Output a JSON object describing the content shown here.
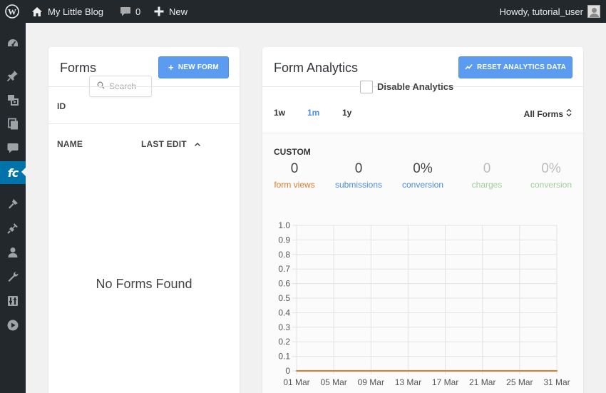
{
  "adminbar": {
    "site_name": "My Little Blog",
    "comment_count": "0",
    "new_label": "New",
    "howdy": "Howdy, tutorial_user"
  },
  "sidebar": {
    "items": [
      {
        "name": "dashboard-icon"
      },
      {
        "name": "posts-pin-icon"
      },
      {
        "name": "media-icon"
      },
      {
        "name": "pages-icon"
      },
      {
        "name": "comments-icon"
      },
      {
        "name": "formcraft-icon",
        "label": "fc",
        "active": true
      },
      {
        "name": "appearance-icon"
      },
      {
        "name": "plugins-icon"
      },
      {
        "name": "users-icon"
      },
      {
        "name": "tools-icon"
      },
      {
        "name": "settings-icon"
      },
      {
        "name": "media-player-icon"
      }
    ]
  },
  "forms": {
    "title": "Forms",
    "new_button": "NEW FORM",
    "search_placeholder": "Search",
    "col_id": "ID",
    "col_name": "NAME",
    "col_last_edit": "LAST EDIT",
    "empty": "No Forms Found"
  },
  "analytics": {
    "title": "Form Analytics",
    "reset_button": "RESET ANALYTICS DATA",
    "disable_label": "Disable Analytics",
    "ranges": [
      "1w",
      "1m",
      "1y"
    ],
    "active_range": "1m",
    "form_filter": "All Forms",
    "period": "CUSTOM",
    "stats": [
      {
        "value": "0",
        "label": "form views",
        "color": "#e07b2a"
      },
      {
        "value": "0",
        "label": "submissions",
        "color": "#4a90e2"
      },
      {
        "value": "0%",
        "label": "conversion",
        "color": "#4a90e2"
      },
      {
        "value": "0",
        "label": "charges",
        "color": "#9fd09a"
      },
      {
        "value": "0%",
        "label": "conversion",
        "color": "#9fd09a"
      }
    ]
  },
  "chart_data": {
    "type": "line",
    "title": "",
    "xlabel": "",
    "ylabel": "",
    "x": [
      "01 Mar",
      "05 Mar",
      "09 Mar",
      "13 Mar",
      "17 Mar",
      "21 Mar",
      "25 Mar",
      "31 Mar"
    ],
    "yticks": [
      "0",
      "0.1",
      "0.2",
      "0.3",
      "0.4",
      "0.5",
      "0.6",
      "0.7",
      "0.8",
      "0.9",
      "1.0"
    ],
    "ylim": [
      0,
      1
    ],
    "grid": true,
    "series": [
      {
        "values": [
          0,
          0,
          0,
          0,
          0,
          0,
          0,
          0
        ],
        "color": "#e07b2a"
      }
    ]
  }
}
